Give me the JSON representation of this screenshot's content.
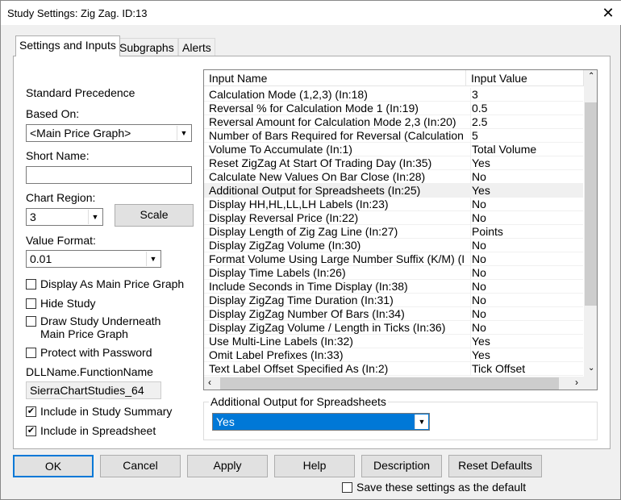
{
  "window": {
    "title": "Study Settings: Zig Zag. ID:13",
    "close": "✕"
  },
  "tabs": [
    {
      "label": "Settings and Inputs"
    },
    {
      "label": "Subgraphs"
    },
    {
      "label": "Alerts"
    }
  ],
  "left": {
    "standard_precedence": "Standard Precedence",
    "based_on_label": "Based On:",
    "based_on_value": "<Main Price Graph>",
    "short_name_label": "Short Name:",
    "short_name_value": "",
    "chart_region_label": "Chart Region:",
    "chart_region_value": "3",
    "scale_button": "Scale",
    "value_format_label": "Value Format:",
    "value_format_value": "0.01",
    "display_as_main": {
      "label": "Display As Main Price Graph",
      "checked": false
    },
    "hide_study": {
      "label": "Hide Study",
      "checked": false
    },
    "draw_underneath": {
      "label1": "Draw Study Underneath",
      "label2": "Main Price Graph",
      "checked": false
    },
    "protect": {
      "label": "Protect with Password",
      "checked": false
    },
    "dll_label": "DLLName.FunctionName",
    "dll_value": "SierraChartStudies_64",
    "include_summary": {
      "label": "Include in Study Summary",
      "checked": true
    },
    "include_spreadsheet": {
      "label": "Include in Spreadsheet",
      "checked": true
    }
  },
  "grid": {
    "headers": [
      "Input Name",
      "Input Value"
    ],
    "rows": [
      {
        "name": "Calculation Mode (1,2,3)   (In:18)",
        "value": "3"
      },
      {
        "name": "Reversal % for Calculation Mode 1   (In:19)",
        "value": "0.5"
      },
      {
        "name": "Reversal Amount for Calculation Mode 2,3   (In:20)",
        "value": "2.5"
      },
      {
        "name": "Number of Bars Required for Reversal (Calculation ...",
        "value": "5"
      },
      {
        "name": "Volume To Accumulate   (In:1)",
        "value": "Total Volume"
      },
      {
        "name": "Reset ZigZag At Start Of Trading Day   (In:35)",
        "value": "Yes"
      },
      {
        "name": "Calculate New Values On Bar Close   (In:28)",
        "value": "No"
      },
      {
        "name": "Additional Output for Spreadsheets   (In:25)",
        "value": "Yes",
        "selected": true
      },
      {
        "name": "Display HH,HL,LL,LH Labels   (In:23)",
        "value": "No"
      },
      {
        "name": "Display Reversal Price   (In:22)",
        "value": "No"
      },
      {
        "name": "Display Length of Zig Zag Line   (In:27)",
        "value": "Points"
      },
      {
        "name": "Display ZigZag Volume   (In:30)",
        "value": "No"
      },
      {
        "name": "Format Volume Using Large Number Suffix (K/M)   (I...",
        "value": "No"
      },
      {
        "name": "Display Time Labels   (In:26)",
        "value": "No"
      },
      {
        "name": "Include Seconds in Time Display   (In:38)",
        "value": "No"
      },
      {
        "name": "Display ZigZag Time Duration   (In:31)",
        "value": "No"
      },
      {
        "name": "Display ZigZag Number Of Bars   (In:34)",
        "value": "No"
      },
      {
        "name": "Display ZigZag Volume / Length in Ticks   (In:36)",
        "value": "No"
      },
      {
        "name": "Use Multi-Line Labels   (In:32)",
        "value": "Yes"
      },
      {
        "name": "Omit Label Prefixes   (In:33)",
        "value": "Yes"
      },
      {
        "name": "Text Label Offset Specified As   (In:2)",
        "value": "Tick Offset"
      }
    ]
  },
  "editor": {
    "label": "Additional Output for Spreadsheets",
    "value": "Yes",
    "highlight": "#0078d7"
  },
  "buttons": {
    "ok": "OK",
    "cancel": "Cancel",
    "apply": "Apply",
    "help": "Help",
    "description": "Description",
    "reset": "Reset Defaults"
  },
  "save_default": {
    "label": "Save these settings as the default",
    "checked": false
  }
}
